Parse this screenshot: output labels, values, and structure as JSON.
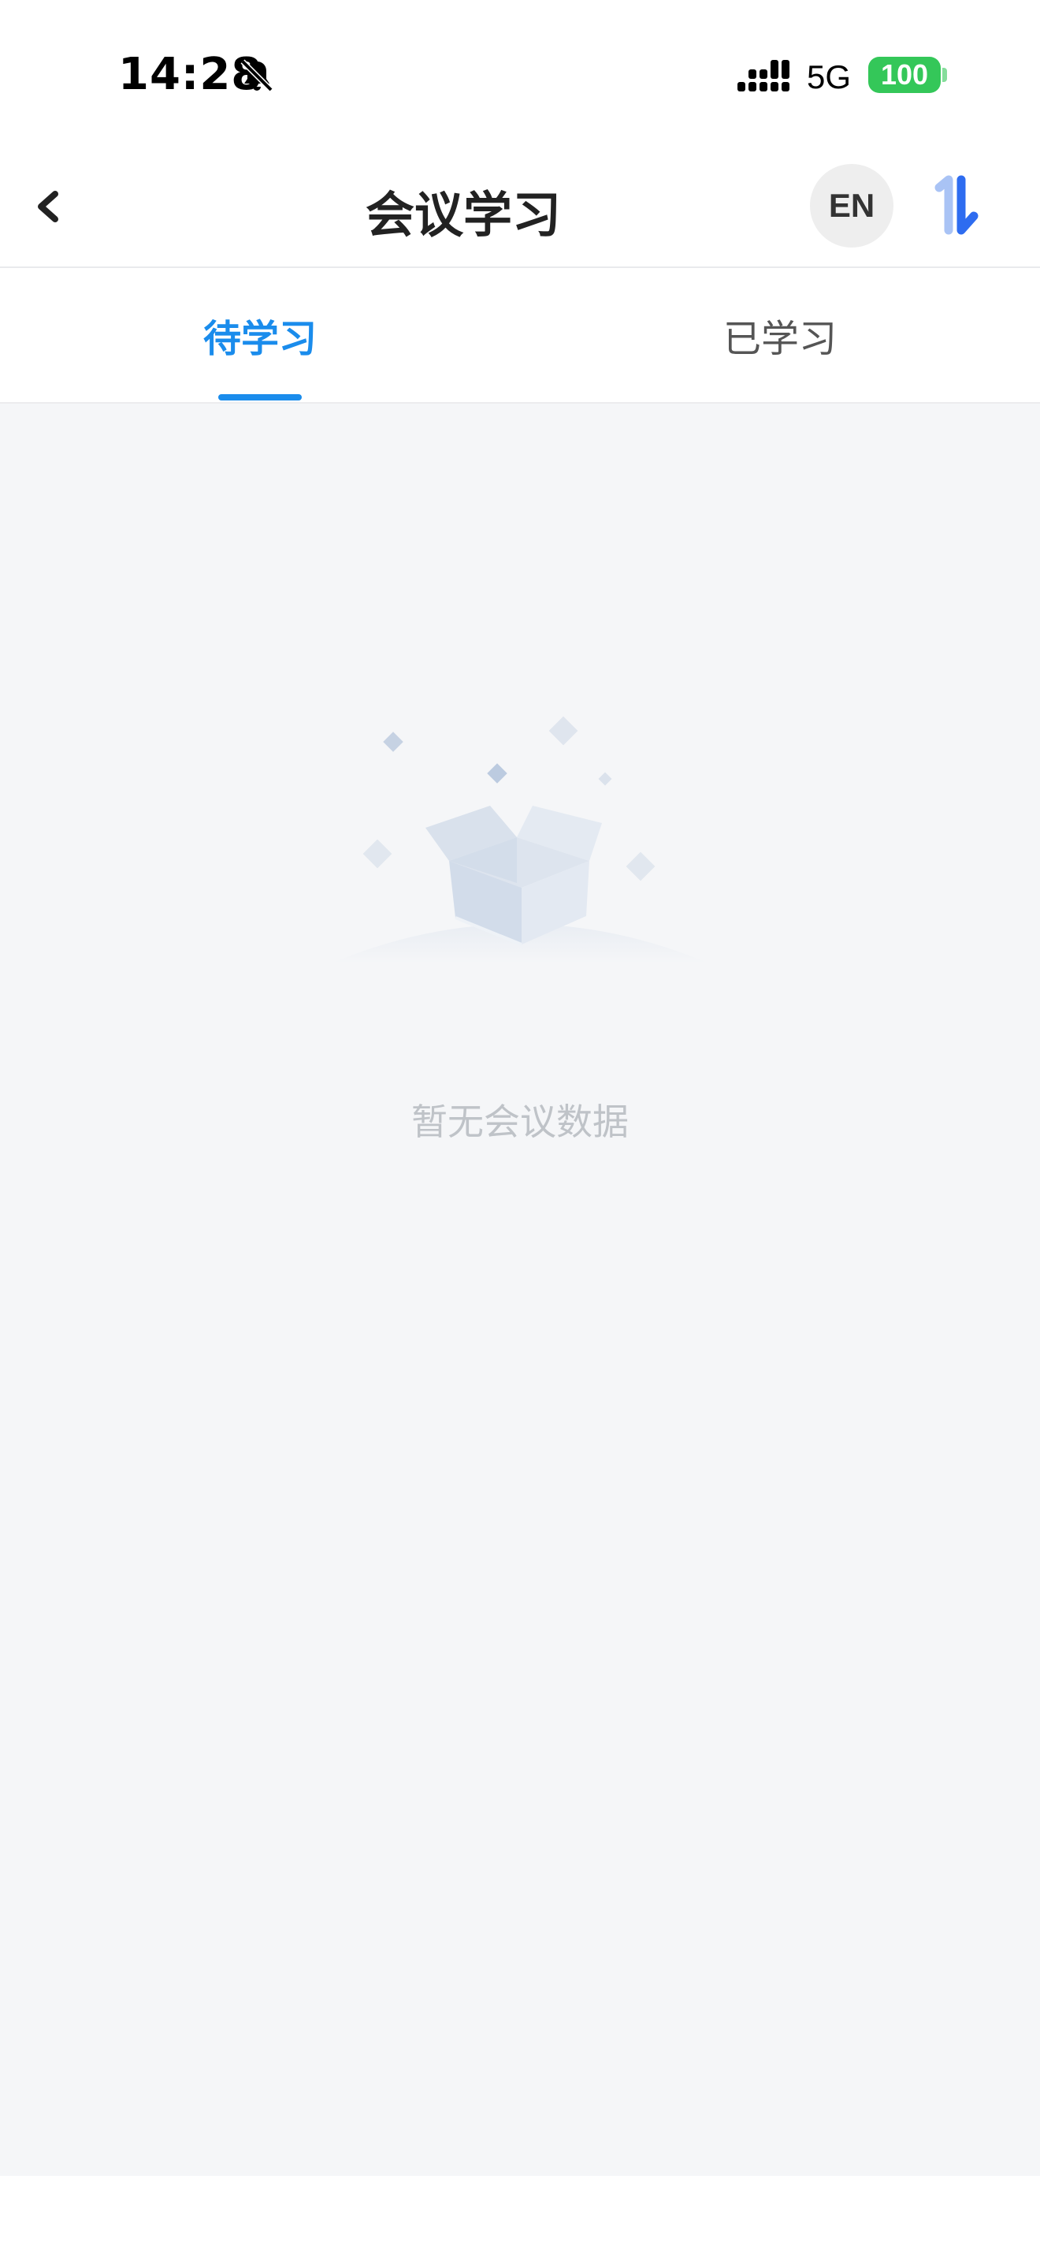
{
  "status_bar": {
    "time": "14:28",
    "network": "5G",
    "battery": "100",
    "icons": [
      "bell-slash-icon",
      "signal-icon",
      "battery-icon"
    ]
  },
  "nav": {
    "title": "会议学习",
    "language_button": "EN",
    "icons": [
      "chevron-left-icon",
      "sort-icon"
    ]
  },
  "tabs": [
    {
      "label": "待学习",
      "active": true
    },
    {
      "label": "已学习",
      "active": false
    }
  ],
  "empty_state": {
    "message": "暂无会议数据",
    "icon": "empty-box-icon"
  },
  "colors": {
    "accent": "#1a8cec",
    "battery": "#34c759",
    "background": "#f5f6f8",
    "empty_text": "#bfc3c8"
  }
}
